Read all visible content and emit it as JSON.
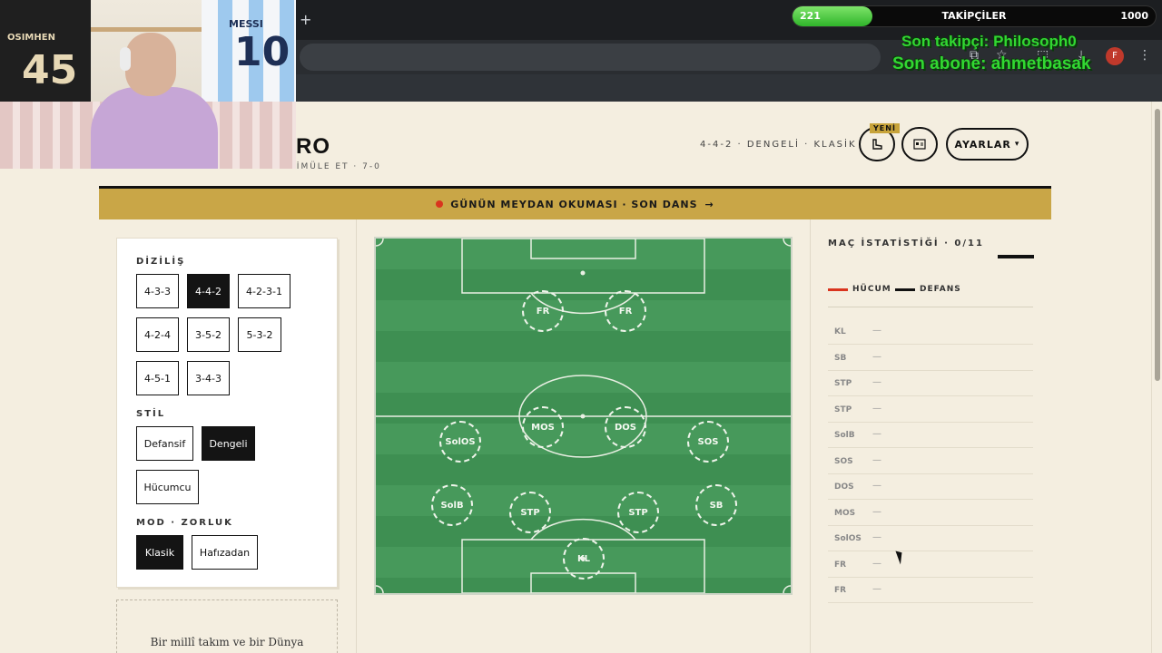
{
  "browser": {
    "new_tab_glyph": "+",
    "profile_initial": "F"
  },
  "overlay": {
    "followers_label": "TAKİPÇİLER",
    "followers_count": "221",
    "followers_goal": "1000",
    "followers_progress": 0.221,
    "last_follower": "Son takipçi: Philosoph0",
    "last_subscriber": "Son abone: ahmetbasak",
    "accent_color": "#32d832"
  },
  "webcam": {
    "jersey1_name": "OSIMHEN",
    "jersey1_number": "45",
    "jersey2_name": "MESSI",
    "jersey2_number": "10"
  },
  "header": {
    "title": "RO",
    "subtitle": "KUR · SİMÜLE ET · 7-0",
    "summary": "4-4-2 · DENGELİ · KLASİK",
    "new_badge": "YENİ",
    "settings_label": "AYARLAR",
    "settings_caret": "▾",
    "icons": [
      "boot-icon",
      "id-card-icon"
    ]
  },
  "challenge": {
    "text": "GÜNÜN MEYDAN OKUMASI · SON DANS",
    "arrow": "→",
    "color": "#c9a647"
  },
  "formation": {
    "label": "DİZİLİŞ",
    "options": [
      {
        "label": "4-3-3",
        "active": false
      },
      {
        "label": "4-4-2",
        "active": true
      },
      {
        "label": "4-2-3-1",
        "active": false
      },
      {
        "label": "4-2-4",
        "active": false
      },
      {
        "label": "3-5-2",
        "active": false
      },
      {
        "label": "5-3-2",
        "active": false
      },
      {
        "label": "4-5-1",
        "active": false
      },
      {
        "label": "3-4-3",
        "active": false
      }
    ]
  },
  "style": {
    "label": "STİL",
    "options": [
      {
        "label": "Defansif",
        "active": false
      },
      {
        "label": "Dengeli",
        "active": true
      },
      {
        "label": "Hücumcu",
        "active": false
      }
    ]
  },
  "mode": {
    "label": "MOD · ZORLUK",
    "options": [
      {
        "label": "Klasik",
        "active": true
      },
      {
        "label": "Hafızadan",
        "active": false
      }
    ]
  },
  "bottom_card_text": "Bir millî takım ve bir Dünya",
  "pitch": {
    "positions": [
      "FR",
      "FR",
      "SolOS",
      "MOS",
      "DOS",
      "SOS",
      "SolB",
      "STP",
      "STP",
      "SB",
      "KL"
    ]
  },
  "stats": {
    "title": "MAÇ İSTATİSTİĞİ · 0/11",
    "legend": [
      {
        "label": "HÜCUM",
        "color": "#d9341e"
      },
      {
        "label": "DEFANS",
        "color": "#111111"
      }
    ],
    "rows": [
      {
        "code": "KL",
        "value": "—"
      },
      {
        "code": "SB",
        "value": "—"
      },
      {
        "code": "STP",
        "value": "—"
      },
      {
        "code": "STP",
        "value": "—"
      },
      {
        "code": "SolB",
        "value": "—"
      },
      {
        "code": "SOS",
        "value": "—"
      },
      {
        "code": "DOS",
        "value": "—"
      },
      {
        "code": "MOS",
        "value": "—"
      },
      {
        "code": "SolOS",
        "value": "—"
      },
      {
        "code": "FR",
        "value": "—"
      },
      {
        "code": "FR",
        "value": "—"
      }
    ]
  }
}
